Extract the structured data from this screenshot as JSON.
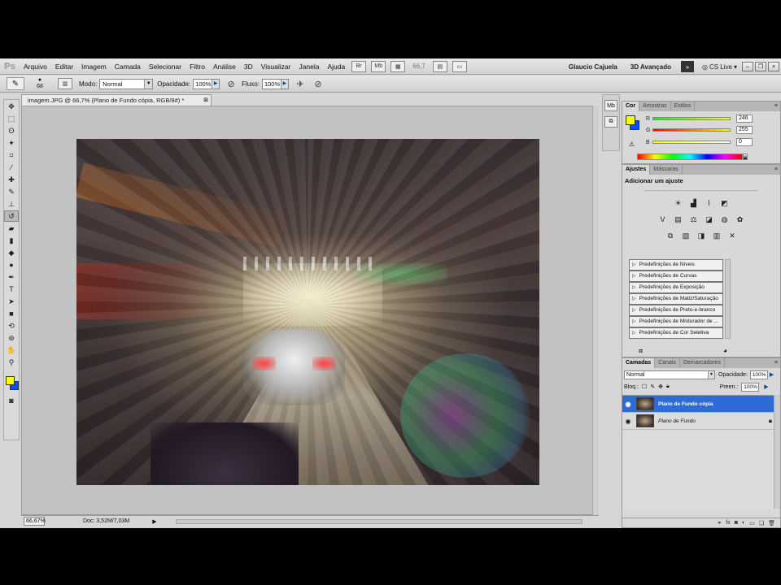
{
  "app": {
    "logo": "Ps",
    "menus": [
      "Arquivo",
      "Editar",
      "Imagem",
      "Camada",
      "Selecionar",
      "Filtro",
      "Análise",
      "3D",
      "Visualizar",
      "Janela",
      "Ajuda"
    ],
    "zoom": "66,7",
    "workspace_user": "Glaucio Cajuela",
    "workspace_3d": "3D Avançado",
    "cs_live": "CS Live",
    "workspace_more": "»"
  },
  "options": {
    "tool_icon": "brush-tool-icon",
    "brush_size": "68",
    "mode_label": "Modo:",
    "mode_value": "Normal",
    "opacity_label": "Opacidade:",
    "opacity_value": "100%",
    "flow_label": "Fluxo:",
    "flow_value": "100%"
  },
  "document": {
    "tab_title": "imagem.JPG @ 66,7% (Plano de Fundo cópia, RGB/8#) *",
    "status_zoom": "66,67%",
    "status_doc": "Doc: 3,52M/7,03M"
  },
  "colors": {
    "foreground": "#f6ff00",
    "background": "#0050ff",
    "selection": "#2f6bd6"
  },
  "cor_panel": {
    "tabs": [
      "Cor",
      "Amostras",
      "Estilos"
    ],
    "r_label": "R",
    "r_value": "246",
    "g_label": "G",
    "g_value": "255",
    "b_label": "B",
    "b_value": "0"
  },
  "ajustes_panel": {
    "tabs": [
      "Ajustes",
      "Máscaras"
    ],
    "title": "Adicionar um ajuste",
    "presets": [
      "Predefinições de Níveis",
      "Predefinições de Curvas",
      "Predefinições de Exposição",
      "Predefinições de Matiz/Saturação",
      "Predefinições de Preto-e-branco",
      "Predefinições de Misturador de ...",
      "Predefinições de Cor Seletiva"
    ]
  },
  "layers_panel": {
    "tabs": [
      "Camadas",
      "Canais",
      "Demarcadores"
    ],
    "blend_mode": "Normal",
    "opacity_label": "Opacidade:",
    "opacity_value": "100%",
    "lock_label": "Bloq.:",
    "fill_label": "Preen.:",
    "fill_value": "100%",
    "layers": [
      {
        "name": "Plano de Fundo cópia",
        "selected": true
      },
      {
        "name": "Plano de Fundo",
        "selected": false,
        "locked": true
      }
    ]
  }
}
